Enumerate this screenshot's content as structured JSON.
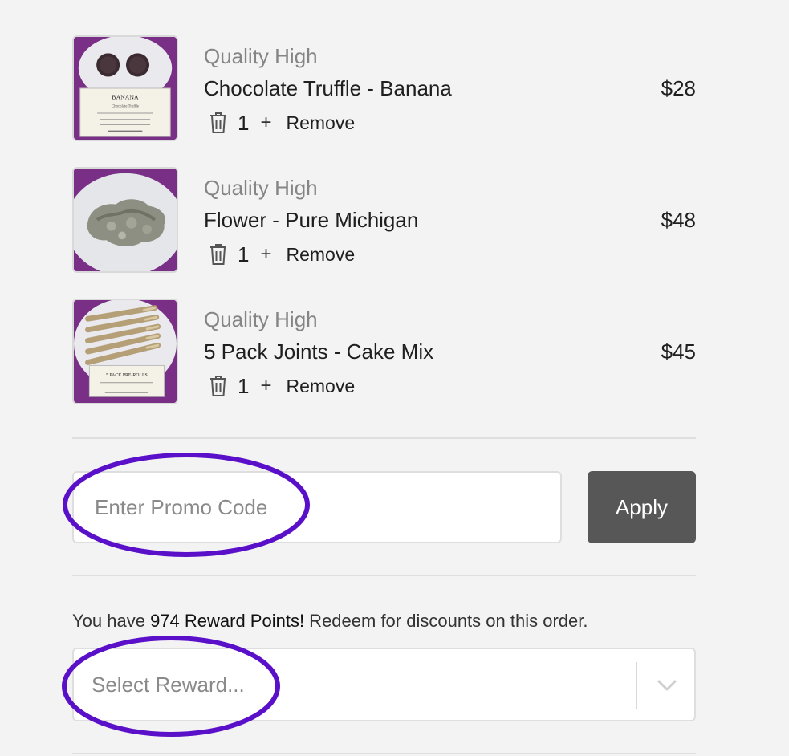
{
  "cart": {
    "items": [
      {
        "quality": "Quality High",
        "name": "Chocolate Truffle - Banana",
        "price": "$28",
        "quantity": "1",
        "plus": "+",
        "remove": "Remove"
      },
      {
        "quality": "Quality High",
        "name": "Flower - Pure Michigan",
        "price": "$48",
        "quantity": "1",
        "plus": "+",
        "remove": "Remove"
      },
      {
        "quality": "Quality High",
        "name": "5 Pack Joints - Cake Mix",
        "price": "$45",
        "quantity": "1",
        "plus": "+",
        "remove": "Remove"
      }
    ],
    "thumb_labels": {
      "item1_title": "BANANA",
      "item1_sub": "Chocolate Truffle",
      "item3_title": "5 PACK PRE-ROLLS"
    }
  },
  "promo": {
    "placeholder": "Enter Promo Code",
    "apply_label": "Apply"
  },
  "rewards": {
    "prefix": "You have ",
    "points_text": "974 Reward Points!",
    "suffix": " Redeem for discounts on this order.",
    "select_placeholder": "Select Reward..."
  },
  "colors": {
    "annotation": "#5a0fc8",
    "apply_button": "#575757",
    "thumb_background": "#7a2f86"
  },
  "icons": [
    "trash-icon",
    "chevron-down-icon"
  ]
}
